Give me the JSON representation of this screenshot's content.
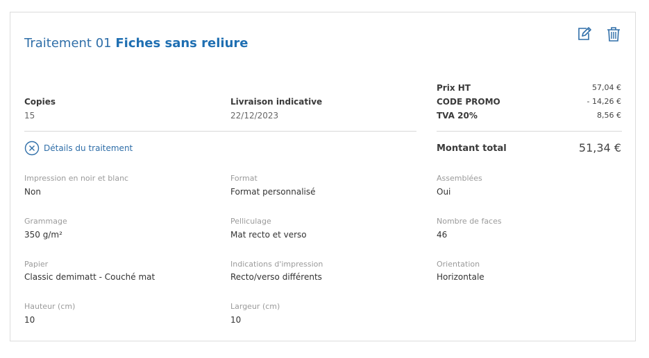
{
  "header": {
    "title_prefix": "Traitement 01",
    "title_main": "Fiches sans reliure",
    "edit_icon": "edit-icon",
    "delete_icon": "trash-icon"
  },
  "summary": {
    "copies_label": "Copies",
    "copies_value": "15",
    "delivery_label": "Livraison indicative",
    "delivery_value": "22/12/2023"
  },
  "pricing": {
    "rows": [
      {
        "label": "Prix HT",
        "value": "57,04 €"
      },
      {
        "label": "CODE PROMO",
        "value": "- 14,26 €"
      },
      {
        "label": "TVA 20%",
        "value": "8,56 €"
      }
    ],
    "total_label": "Montant total",
    "total_value": "51,34 €"
  },
  "details": {
    "toggle_label": "Détails du traitement",
    "toggle_icon": "close-circle-icon",
    "fields": [
      {
        "label": "Impression en noir et blanc",
        "value": "Non"
      },
      {
        "label": "Format",
        "value": "Format personnalisé"
      },
      {
        "label": "Assemblées",
        "value": "Oui"
      },
      {
        "label": "Grammage",
        "value": "350 g/m²"
      },
      {
        "label": "Pelliculage",
        "value": "Mat recto et verso"
      },
      {
        "label": "Nombre de faces",
        "value": "46"
      },
      {
        "label": "Papier",
        "value": "Classic demimatt - Couché mat"
      },
      {
        "label": "Indications d'impression",
        "value": "Recto/verso différents"
      },
      {
        "label": "Orientation",
        "value": "Horizontale"
      },
      {
        "label": "Hauteur (cm)",
        "value": "10"
      },
      {
        "label": "Largeur (cm)",
        "value": "10"
      }
    ]
  },
  "colors": {
    "accent": "#2f6ea8",
    "text": "#333333",
    "muted": "#9a9a9a",
    "border": "#dcdcdc"
  }
}
